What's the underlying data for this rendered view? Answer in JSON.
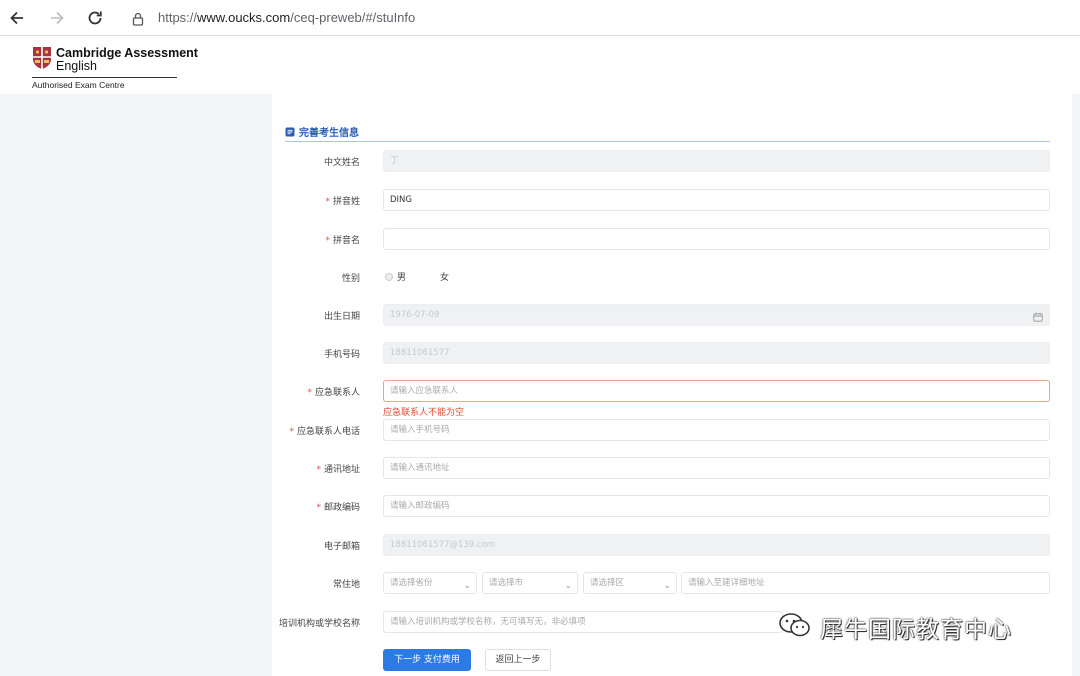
{
  "browser": {
    "url_prefix": "https://",
    "url_host": "www.oucks.com",
    "url_path": "/ceq-preweb/#/stuInfo"
  },
  "header": {
    "logo_line1": "Cambridge Assessment",
    "logo_line2": "English",
    "logo_line3": "Authorised Exam Centre"
  },
  "section": {
    "title": "完善考生信息"
  },
  "form": {
    "chinese_name": {
      "label": "中文姓名",
      "value": "丁"
    },
    "pinyin_surname": {
      "label": "拼音姓",
      "value": "DING"
    },
    "pinyin_given": {
      "label": "拼音名",
      "value": ""
    },
    "gender": {
      "label": "性别",
      "options": [
        "男",
        "女"
      ],
      "selected": "男"
    },
    "birth_date": {
      "label": "出生日期",
      "value": "1976-07-09"
    },
    "mobile": {
      "label": "手机号码",
      "value": "18811061577"
    },
    "emergency_contact": {
      "label": "应急联系人",
      "placeholder": "请输入应急联系人",
      "error": "应急联系人不能为空"
    },
    "emergency_phone": {
      "label": "应急联系人电话",
      "placeholder": "请输入手机号码"
    },
    "address": {
      "label": "通讯地址",
      "placeholder": "请输入通讯地址"
    },
    "postcode": {
      "label": "邮政编码",
      "placeholder": "请输入邮政编码"
    },
    "email": {
      "label": "电子邮箱",
      "value": "18811061577@139.com"
    },
    "residence": {
      "label": "常住地",
      "province_placeholder": "请选择省份",
      "city_placeholder": "请选择市",
      "district_placeholder": "请选择区",
      "detail_placeholder": "请输入至建详细地址"
    },
    "school": {
      "label": "培训机构或学校名称",
      "placeholder": "请输入培训机构或学校名称，无可填写无，非必填项"
    }
  },
  "buttons": {
    "next": "下一步 支付费用",
    "back": "返回上一步"
  },
  "watermark": {
    "text": "犀牛国际教育中心"
  },
  "colors": {
    "primary": "#2c7be5",
    "error": "#e24a36",
    "required": "#e04e4e",
    "section_title": "#2a5db0"
  }
}
